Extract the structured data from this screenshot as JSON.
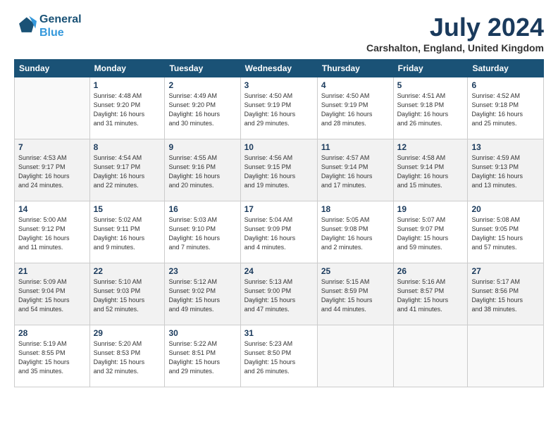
{
  "logo": {
    "line1": "General",
    "line2": "Blue"
  },
  "title": "July 2024",
  "subtitle": "Carshalton, England, United Kingdom",
  "days_of_week": [
    "Sunday",
    "Monday",
    "Tuesday",
    "Wednesday",
    "Thursday",
    "Friday",
    "Saturday"
  ],
  "weeks": [
    [
      {
        "day": "",
        "info": ""
      },
      {
        "day": "1",
        "info": "Sunrise: 4:48 AM\nSunset: 9:20 PM\nDaylight: 16 hours\nand 31 minutes."
      },
      {
        "day": "2",
        "info": "Sunrise: 4:49 AM\nSunset: 9:20 PM\nDaylight: 16 hours\nand 30 minutes."
      },
      {
        "day": "3",
        "info": "Sunrise: 4:50 AM\nSunset: 9:19 PM\nDaylight: 16 hours\nand 29 minutes."
      },
      {
        "day": "4",
        "info": "Sunrise: 4:50 AM\nSunset: 9:19 PM\nDaylight: 16 hours\nand 28 minutes."
      },
      {
        "day": "5",
        "info": "Sunrise: 4:51 AM\nSunset: 9:18 PM\nDaylight: 16 hours\nand 26 minutes."
      },
      {
        "day": "6",
        "info": "Sunrise: 4:52 AM\nSunset: 9:18 PM\nDaylight: 16 hours\nand 25 minutes."
      }
    ],
    [
      {
        "day": "7",
        "info": "Sunrise: 4:53 AM\nSunset: 9:17 PM\nDaylight: 16 hours\nand 24 minutes."
      },
      {
        "day": "8",
        "info": "Sunrise: 4:54 AM\nSunset: 9:17 PM\nDaylight: 16 hours\nand 22 minutes."
      },
      {
        "day": "9",
        "info": "Sunrise: 4:55 AM\nSunset: 9:16 PM\nDaylight: 16 hours\nand 20 minutes."
      },
      {
        "day": "10",
        "info": "Sunrise: 4:56 AM\nSunset: 9:15 PM\nDaylight: 16 hours\nand 19 minutes."
      },
      {
        "day": "11",
        "info": "Sunrise: 4:57 AM\nSunset: 9:14 PM\nDaylight: 16 hours\nand 17 minutes."
      },
      {
        "day": "12",
        "info": "Sunrise: 4:58 AM\nSunset: 9:14 PM\nDaylight: 16 hours\nand 15 minutes."
      },
      {
        "day": "13",
        "info": "Sunrise: 4:59 AM\nSunset: 9:13 PM\nDaylight: 16 hours\nand 13 minutes."
      }
    ],
    [
      {
        "day": "14",
        "info": "Sunrise: 5:00 AM\nSunset: 9:12 PM\nDaylight: 16 hours\nand 11 minutes."
      },
      {
        "day": "15",
        "info": "Sunrise: 5:02 AM\nSunset: 9:11 PM\nDaylight: 16 hours\nand 9 minutes."
      },
      {
        "day": "16",
        "info": "Sunrise: 5:03 AM\nSunset: 9:10 PM\nDaylight: 16 hours\nand 7 minutes."
      },
      {
        "day": "17",
        "info": "Sunrise: 5:04 AM\nSunset: 9:09 PM\nDaylight: 16 hours\nand 4 minutes."
      },
      {
        "day": "18",
        "info": "Sunrise: 5:05 AM\nSunset: 9:08 PM\nDaylight: 16 hours\nand 2 minutes."
      },
      {
        "day": "19",
        "info": "Sunrise: 5:07 AM\nSunset: 9:07 PM\nDaylight: 15 hours\nand 59 minutes."
      },
      {
        "day": "20",
        "info": "Sunrise: 5:08 AM\nSunset: 9:05 PM\nDaylight: 15 hours\nand 57 minutes."
      }
    ],
    [
      {
        "day": "21",
        "info": "Sunrise: 5:09 AM\nSunset: 9:04 PM\nDaylight: 15 hours\nand 54 minutes."
      },
      {
        "day": "22",
        "info": "Sunrise: 5:10 AM\nSunset: 9:03 PM\nDaylight: 15 hours\nand 52 minutes."
      },
      {
        "day": "23",
        "info": "Sunrise: 5:12 AM\nSunset: 9:02 PM\nDaylight: 15 hours\nand 49 minutes."
      },
      {
        "day": "24",
        "info": "Sunrise: 5:13 AM\nSunset: 9:00 PM\nDaylight: 15 hours\nand 47 minutes."
      },
      {
        "day": "25",
        "info": "Sunrise: 5:15 AM\nSunset: 8:59 PM\nDaylight: 15 hours\nand 44 minutes."
      },
      {
        "day": "26",
        "info": "Sunrise: 5:16 AM\nSunset: 8:57 PM\nDaylight: 15 hours\nand 41 minutes."
      },
      {
        "day": "27",
        "info": "Sunrise: 5:17 AM\nSunset: 8:56 PM\nDaylight: 15 hours\nand 38 minutes."
      }
    ],
    [
      {
        "day": "28",
        "info": "Sunrise: 5:19 AM\nSunset: 8:55 PM\nDaylight: 15 hours\nand 35 minutes."
      },
      {
        "day": "29",
        "info": "Sunrise: 5:20 AM\nSunset: 8:53 PM\nDaylight: 15 hours\nand 32 minutes."
      },
      {
        "day": "30",
        "info": "Sunrise: 5:22 AM\nSunset: 8:51 PM\nDaylight: 15 hours\nand 29 minutes."
      },
      {
        "day": "31",
        "info": "Sunrise: 5:23 AM\nSunset: 8:50 PM\nDaylight: 15 hours\nand 26 minutes."
      },
      {
        "day": "",
        "info": ""
      },
      {
        "day": "",
        "info": ""
      },
      {
        "day": "",
        "info": ""
      }
    ]
  ],
  "colors": {
    "header_bg": "#1a5276",
    "header_text": "#ffffff",
    "title_color": "#1a3a5c",
    "border": "#cccccc"
  }
}
